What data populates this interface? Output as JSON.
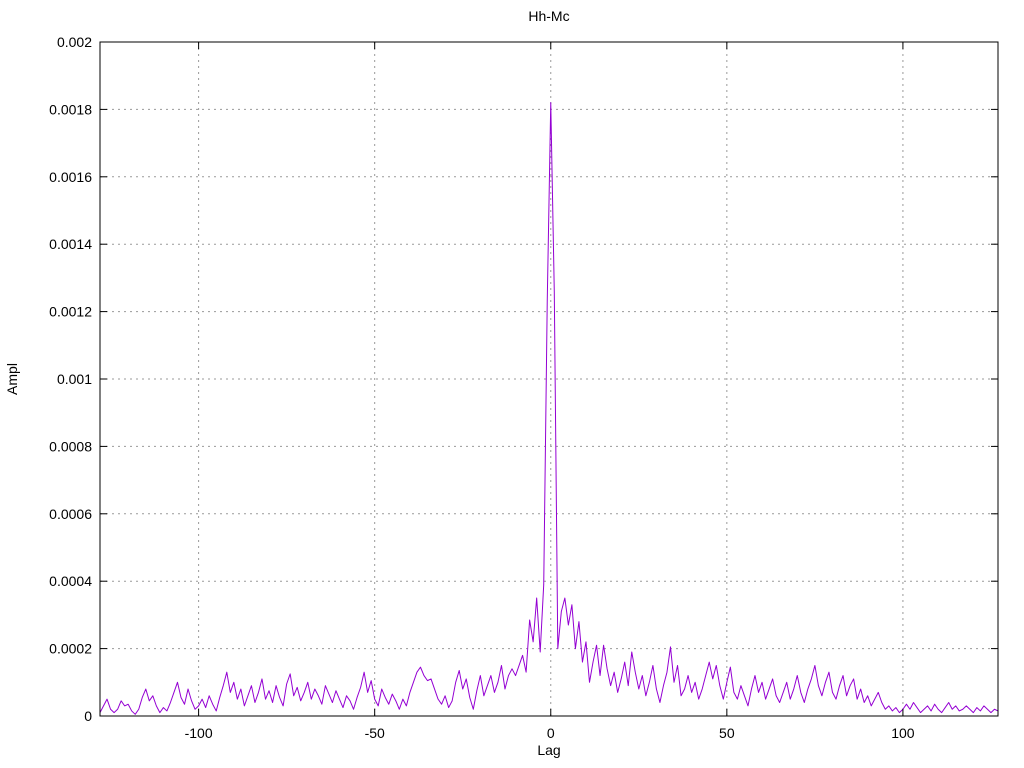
{
  "title": "Hh-Mc",
  "chart_data": {
    "type": "line",
    "title": "Hh-Mc",
    "xlabel": "Lag",
    "ylabel": "Ampl",
    "xlim": [
      -128,
      127
    ],
    "ylim": [
      0,
      0.002
    ],
    "xticks": [
      -100,
      -50,
      0,
      50,
      100
    ],
    "xtick_labels": [
      "-100",
      "-50",
      "0",
      "50",
      "100"
    ],
    "yticks": [
      0,
      0.0002,
      0.0004,
      0.0006,
      0.0008,
      0.001,
      0.0012,
      0.0014,
      0.0016,
      0.0018,
      0.002
    ],
    "ytick_labels": [
      "0",
      "0.0002",
      "0.0004",
      "0.0006",
      "0.0008",
      "0.001",
      "0.0012",
      "0.0014",
      "0.0016",
      "0.0018",
      "0.002"
    ],
    "grid": true,
    "legend": false,
    "line_color": "#9400d3",
    "grid_color": "#9a9a9a",
    "border_color": "#000000",
    "peak": {
      "lag": 0,
      "ampl": 0.00182
    },
    "series": [
      {
        "name": "Hh-Mc",
        "x_start": -128,
        "x_step": 1,
        "values": [
          1e-05,
          3e-05,
          5e-05,
          2e-05,
          1e-05,
          2e-05,
          4.5e-05,
          3e-05,
          3.5e-05,
          1.5e-05,
          5e-06,
          2e-05,
          5.5e-05,
          8e-05,
          4.5e-05,
          6e-05,
          3e-05,
          1e-05,
          2.5e-05,
          1.5e-05,
          4e-05,
          7e-05,
          0.0001,
          5.5e-05,
          3.5e-05,
          8e-05,
          4.5e-05,
          2e-05,
          3e-05,
          5e-05,
          2.5e-05,
          6e-05,
          3.5e-05,
          1.5e-05,
          5.5e-05,
          9e-05,
          0.00013,
          7e-05,
          0.0001,
          5e-05,
          8e-05,
          3e-05,
          6e-05,
          9e-05,
          4e-05,
          7e-05,
          0.00011,
          5e-05,
          7.5e-05,
          4e-05,
          9e-05,
          5.5e-05,
          3e-05,
          9.5e-05,
          0.000125,
          6e-05,
          8.5e-05,
          4.5e-05,
          7e-05,
          0.0001,
          5e-05,
          8e-05,
          6e-05,
          3.5e-05,
          9e-05,
          6.5e-05,
          4e-05,
          7.5e-05,
          5e-05,
          2.5e-05,
          6e-05,
          4.5e-05,
          2e-05,
          5.5e-05,
          8.5e-05,
          0.00013,
          7e-05,
          0.000105,
          5e-05,
          3e-05,
          8e-05,
          5.5e-05,
          3.5e-05,
          6.5e-05,
          4.5e-05,
          2e-05,
          5e-05,
          3e-05,
          7e-05,
          0.0001,
          0.00013,
          0.000145,
          0.00012,
          0.000105,
          0.00011,
          8e-05,
          5e-05,
          3.5e-05,
          6e-05,
          2.5e-05,
          4.5e-05,
          0.0001,
          0.000135,
          8e-05,
          0.00011,
          5.5e-05,
          2e-05,
          7.5e-05,
          0.00012,
          6e-05,
          9e-05,
          0.00012,
          7e-05,
          0.0001,
          0.00015,
          8e-05,
          0.00012,
          0.00014,
          0.00012,
          0.00015,
          0.00018,
          0.00013,
          0.000285,
          0.00022,
          0.00035,
          0.00019,
          0.00039,
          0.00123,
          0.00182,
          0.00126,
          0.0002,
          0.00031,
          0.00035,
          0.00027,
          0.00033,
          0.0002,
          0.00028,
          0.00016,
          0.00022,
          0.0001,
          0.00016,
          0.00021,
          0.00012,
          0.00021,
          0.00014,
          9e-05,
          0.00013,
          7e-05,
          0.00011,
          0.00016,
          9e-05,
          0.00019,
          0.00013,
          8e-05,
          0.00012,
          6e-05,
          0.0001,
          0.00015,
          8e-05,
          4e-05,
          9e-05,
          0.00013,
          0.000205,
          0.0001,
          0.00015,
          6e-05,
          8e-05,
          0.00012,
          7e-05,
          0.0001,
          5e-05,
          8e-05,
          0.00012,
          0.00016,
          0.00011,
          0.00015,
          9e-05,
          5e-05,
          0.0001,
          0.000145,
          7e-05,
          5e-05,
          9e-05,
          6e-05,
          3e-05,
          8e-05,
          0.00012,
          7e-05,
          0.0001,
          5e-05,
          8e-05,
          0.00011,
          6e-05,
          4e-05,
          7e-05,
          0.0001,
          5e-05,
          8e-05,
          0.00012,
          7e-05,
          4e-05,
          8e-05,
          0.00011,
          0.00015,
          9e-05,
          6e-05,
          0.0001,
          0.00013,
          7e-05,
          5e-05,
          9e-05,
          0.00012,
          6e-05,
          9e-05,
          0.00011,
          5e-05,
          8e-05,
          4e-05,
          6e-05,
          3e-05,
          5e-05,
          7e-05,
          4e-05,
          2e-05,
          3e-05,
          1.5e-05,
          2.5e-05,
          1e-05,
          2e-05,
          3.5e-05,
          2e-05,
          4e-05,
          2.5e-05,
          1e-05,
          2e-05,
          3e-05,
          1.5e-05,
          3.5e-05,
          2e-05,
          1e-05,
          2.5e-05,
          4e-05,
          2e-05,
          3e-05,
          1.5e-05,
          2e-05,
          3e-05,
          2e-05,
          1e-05,
          2.5e-05,
          1.5e-05,
          3e-05,
          2e-05,
          1e-05,
          2e-05,
          1.5e-05
        ]
      }
    ]
  }
}
